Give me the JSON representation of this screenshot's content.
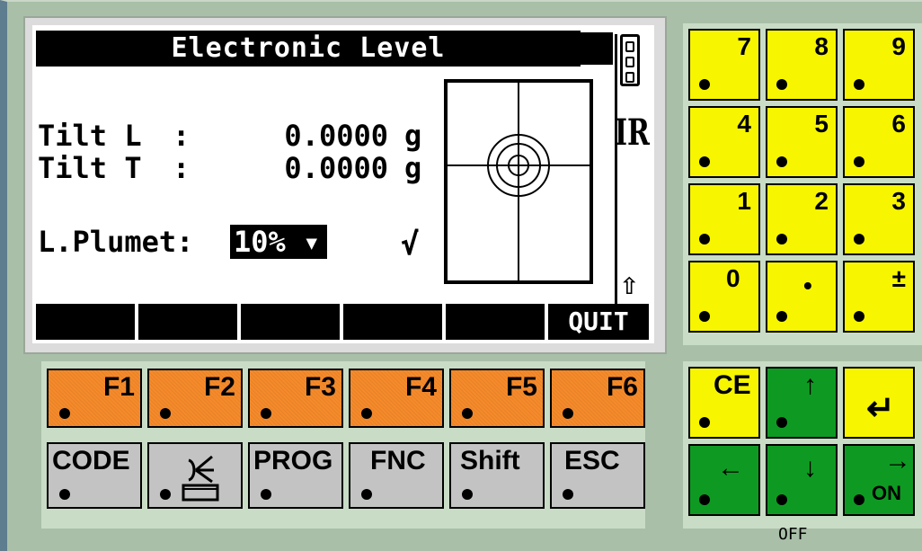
{
  "screen": {
    "title": "Electronic Level",
    "ir_label": "IR",
    "tilt_l": {
      "label": "Tilt L",
      "sep": ":",
      "value": "0.0000",
      "unit": "g"
    },
    "tilt_t": {
      "label": "Tilt T",
      "sep": ":",
      "value": "0.0000",
      "unit": "g"
    },
    "plumet": {
      "label": "L.Plumet:",
      "value": "10%",
      "dropdown_icon": "▾"
    },
    "check": "√",
    "shift_arrow": "⇧",
    "softkeys": [
      "",
      "",
      "",
      "",
      "",
      "QUIT"
    ]
  },
  "fkeys": [
    "F1",
    "F2",
    "F3",
    "F4",
    "F5",
    "F6"
  ],
  "gkeys": [
    "CODE",
    "",
    "PROG",
    "FNC",
    "Shift",
    "ESC"
  ],
  "numpad": [
    [
      "7",
      "8",
      "9"
    ],
    [
      "4",
      "5",
      "6"
    ],
    [
      "1",
      "2",
      "3"
    ],
    [
      "0",
      "•",
      "±"
    ]
  ],
  "nav": {
    "ce": "CE",
    "up": "↑",
    "enter": "↵",
    "left": "←",
    "down": "↓",
    "right": "→",
    "on": "ON",
    "off": "OFF"
  },
  "colors": {
    "fkey": "#f58a2a",
    "numkey": "#f7f500",
    "navkey": "#0e9a22",
    "gkey": "#c3c3c3",
    "panel": "#a9bfa8"
  }
}
